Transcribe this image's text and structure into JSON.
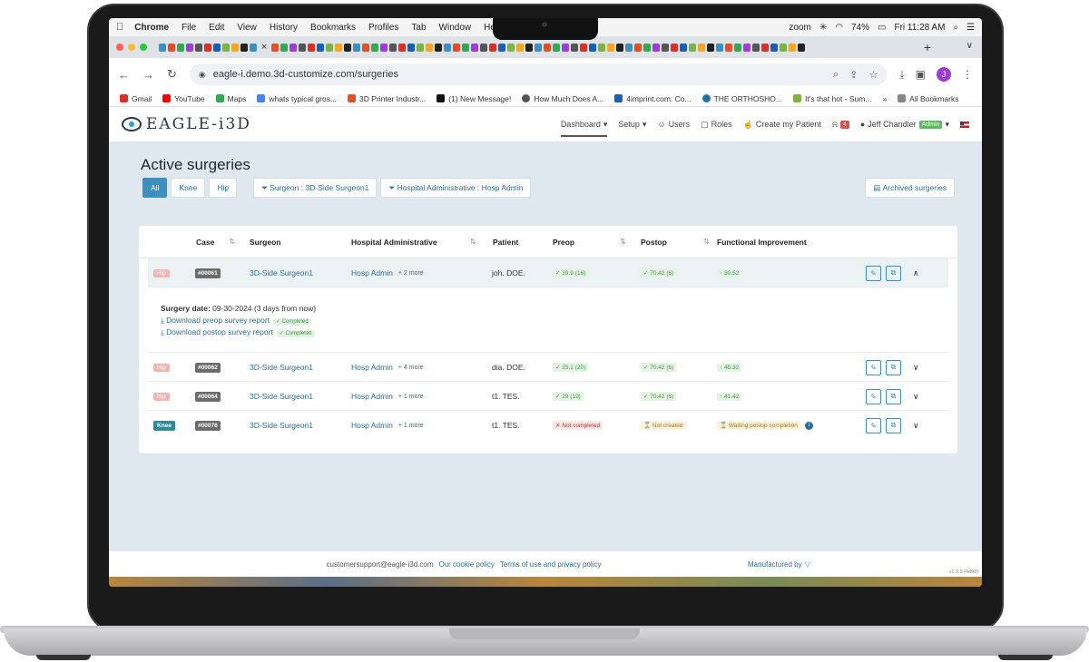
{
  "menubar": {
    "app": "Chrome",
    "items": [
      "File",
      "Edit",
      "View",
      "History",
      "Bookmarks",
      "Profiles",
      "Tab",
      "Window",
      "Help"
    ],
    "zoom": "zoom",
    "battery": "74%",
    "datetime": "Fri 11:28 AM"
  },
  "browser": {
    "url": "eagle-i.demo.3d-customize.com/surgeries",
    "avatar": "J",
    "bookmarks": [
      {
        "label": "Gmail",
        "color": "#d93025"
      },
      {
        "label": "YouTube",
        "color": "#ff0000"
      },
      {
        "label": "Maps",
        "color": "#34a853"
      },
      {
        "label": "whats typical gros...",
        "color": "#4285f4"
      },
      {
        "label": "3D Printer Industr...",
        "color": "#e44d26"
      },
      {
        "label": "(1) New Message!",
        "color": "#111111"
      },
      {
        "label": "How Much Does A...",
        "color": "#555555"
      },
      {
        "label": "4imprint.com: Co...",
        "color": "#1a5fb4"
      },
      {
        "label": "THE ORTHOSHO...",
        "color": "#21759b"
      },
      {
        "label": "It's that hot - Sum...",
        "color": "#7cb342"
      }
    ],
    "all_bookmarks": "All Bookmarks"
  },
  "nav": {
    "logo": "EAGLE-i3D",
    "dashboard": "Dashboard",
    "setup": "Setup",
    "users": "Users",
    "roles": "Roles",
    "create_patient": "Create my Patient",
    "notif_count": "4",
    "user": "Jeff Chandler",
    "role_badge": "Admin"
  },
  "page": {
    "title": "Active surgeries",
    "filters": {
      "all": "All",
      "knee": "Knee",
      "hip": "Hip",
      "surgeon": "Surgeon : 3D-Side Surgeon1",
      "hospital": "Hospital Administrative : Hosp Admin"
    },
    "archived": "Archived surgeries"
  },
  "table": {
    "headers": {
      "case": "Case",
      "surgeon": "Surgeon",
      "hospital": "Hospital Administrative",
      "patient": "Patient",
      "preop": "Preop",
      "postop": "Postop",
      "functional": "Functional Improvement"
    },
    "rows": [
      {
        "type": "Hip",
        "case": "#00061",
        "surgeon": "3D-Side Surgeon1",
        "hospital": "Hosp Admin",
        "more": "+ 2 more",
        "patient": "joh. DOE.",
        "preop": "✓ 39.9 (16)",
        "postop": "✓ 70.42 (6)",
        "functional": "↑ 30.52"
      },
      {
        "type": "Hip",
        "case": "#00062",
        "surgeon": "3D-Side Surgeon1",
        "hospital": "Hosp Admin",
        "more": "+ 4 more",
        "patient": "dia. DOE.",
        "preop": "✓ 25.1 (20)",
        "postop": "✓ 70.42 (6)",
        "functional": "↑ 45.32"
      },
      {
        "type": "Hip",
        "case": "#00064",
        "surgeon": "3D-Side Surgeon1",
        "hospital": "Hosp Admin",
        "more": "+ 1 more",
        "patient": "t1. TES.",
        "preop": "✓ 29 (19)",
        "postop": "✓ 70.42 (6)",
        "functional": "↑ 41.42"
      },
      {
        "type": "Knee",
        "case": "#00076",
        "surgeon": "3D-Side Surgeon1",
        "hospital": "Hosp Admin",
        "more": "+ 1 more",
        "patient": "t1. TES.",
        "preop": "✕ Not completed",
        "postop": "⌛ Not created",
        "functional": "⌛ Waiting postop completion"
      }
    ],
    "detail": {
      "date_label": "Surgery date:",
      "date_value": "09-30-2024 (3 days from now)",
      "preop_link": "Download preop survey report",
      "postop_link": "Download postop survey report",
      "completed": "✓ Completed"
    }
  },
  "footer": {
    "email": "customersupport@eagle-i3d.com",
    "cookie": "Our cookie policy",
    "terms": "Terms of use and privacy policy",
    "manufactured": "Manufactured by",
    "version": "v1.3.9 (4d98)"
  }
}
